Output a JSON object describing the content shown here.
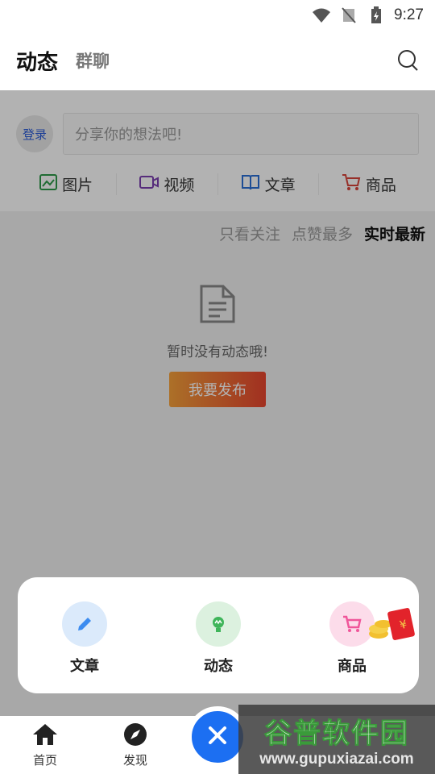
{
  "status_bar": {
    "time": "9:27"
  },
  "header": {
    "tabs": [
      {
        "label": "动态",
        "active": true
      },
      {
        "label": "群聊",
        "active": false
      }
    ]
  },
  "composer": {
    "login_label": "登录",
    "input_placeholder": "分享你的想法吧!",
    "media": [
      {
        "label": "图片",
        "icon": "image-icon"
      },
      {
        "label": "视频",
        "icon": "video-icon"
      },
      {
        "label": "文章",
        "icon": "book-icon"
      },
      {
        "label": "商品",
        "icon": "cart-icon"
      }
    ]
  },
  "sort": {
    "options": [
      "只看关注",
      "点赞最多",
      "实时最新"
    ],
    "active": "实时最新"
  },
  "empty": {
    "message": "暂时没有动态哦!",
    "button": "我要发布"
  },
  "popup": {
    "items": [
      {
        "label": "文章",
        "icon": "pencil-icon",
        "color": "#3c8cf0"
      },
      {
        "label": "动态",
        "icon": "bulb-icon",
        "color": "#3fb55a"
      },
      {
        "label": "商品",
        "icon": "cart-icon",
        "color": "#f0569a"
      }
    ]
  },
  "tabbar": {
    "items": [
      {
        "label": "首页",
        "icon": "home-icon"
      },
      {
        "label": "发现",
        "icon": "compass-icon"
      }
    ]
  },
  "watermark": {
    "title": "谷普软件园",
    "url": "www.gupuxiazai.com"
  },
  "colors": {
    "accent": "#1c6ff2",
    "publish_start": "#f6a13a",
    "publish_end": "#e8452f"
  }
}
